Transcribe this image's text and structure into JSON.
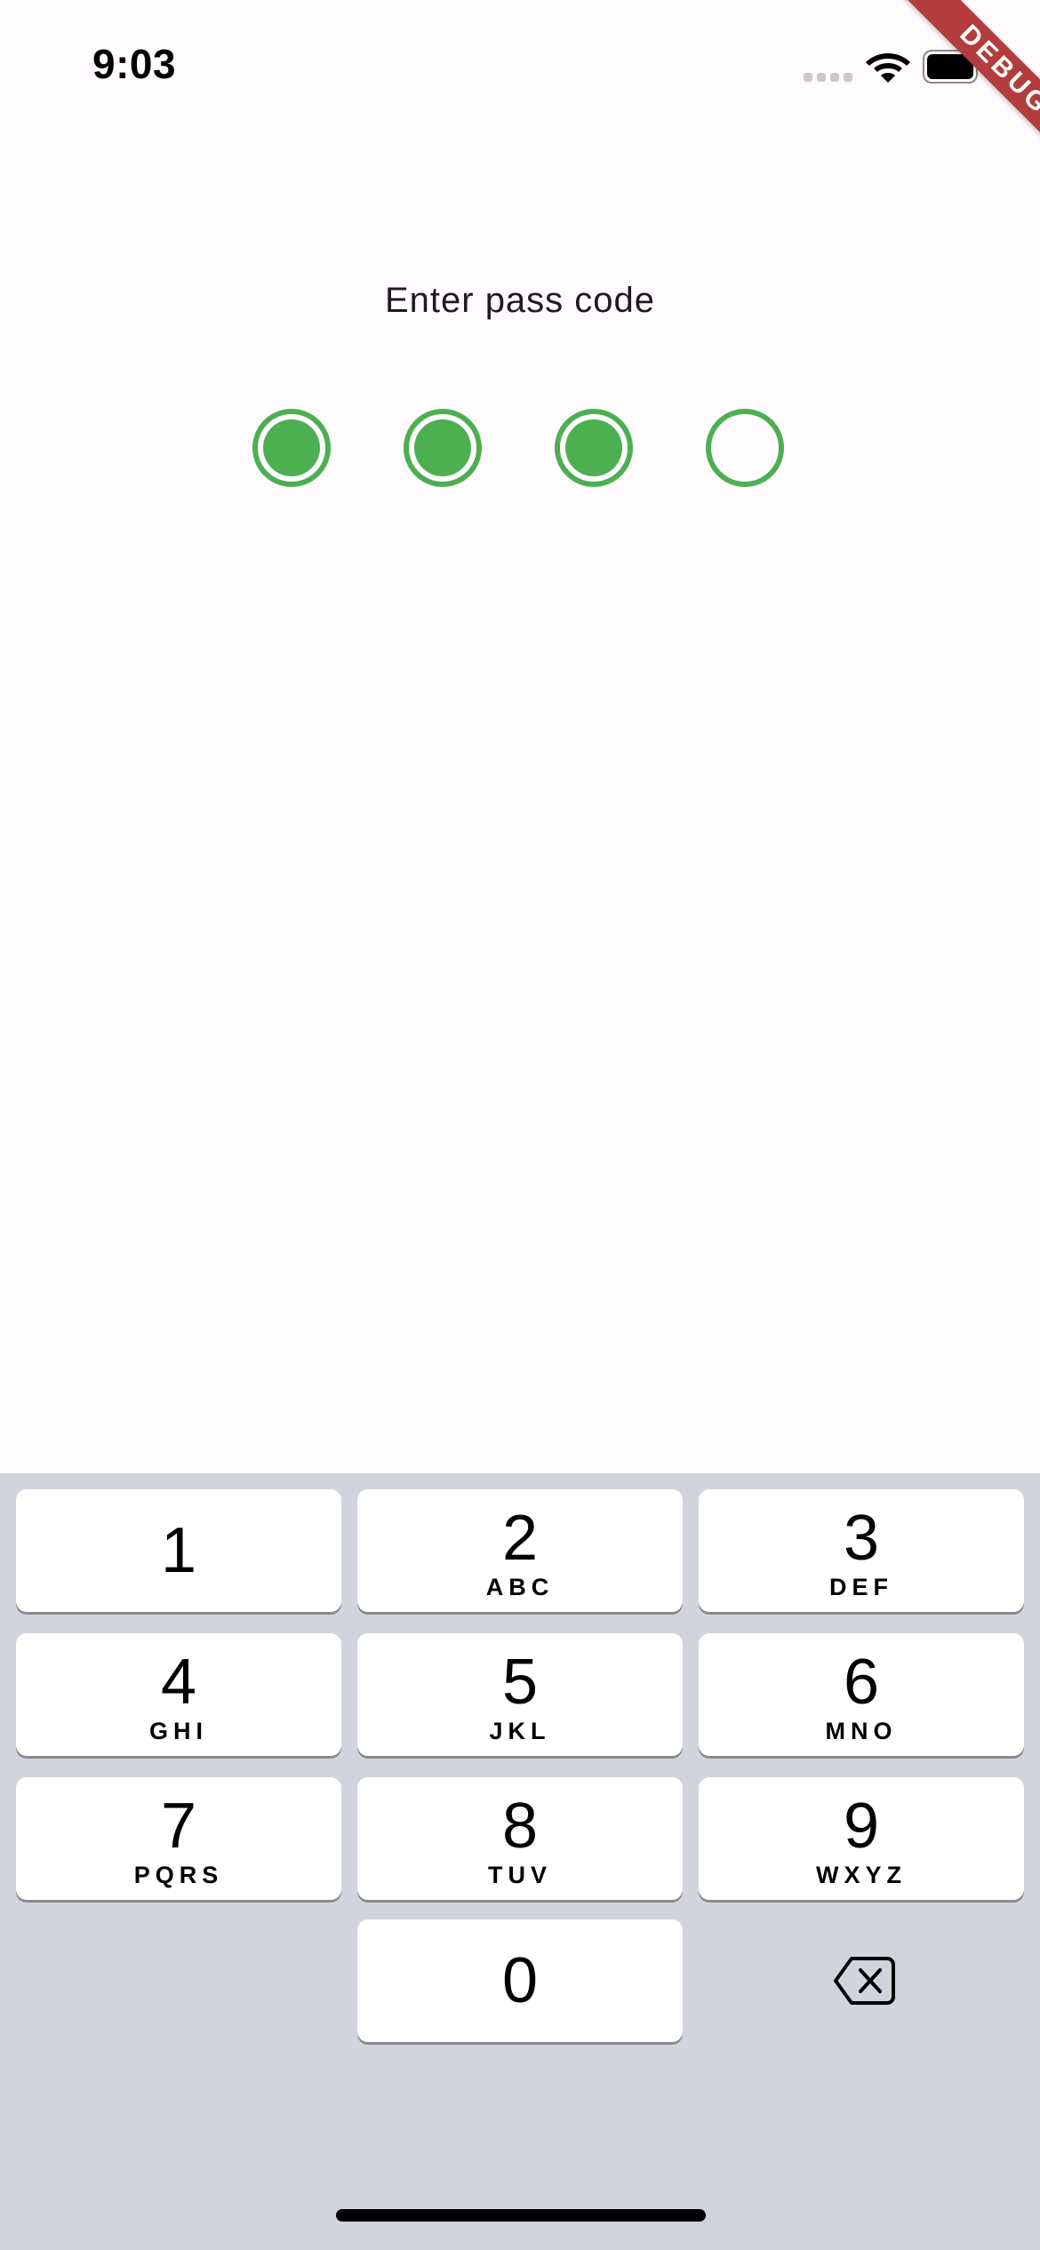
{
  "status_bar": {
    "time": "9:03",
    "icons": [
      "signal-icon",
      "wifi-icon",
      "battery-icon"
    ]
  },
  "debug_banner": {
    "label": "DEBUG",
    "color": "#b33c3c"
  },
  "passcode": {
    "prompt": "Enter pass code",
    "length": 4,
    "entered_count": 3,
    "accent_color": "#4caf50"
  },
  "keypad": {
    "background": "#d1d4db",
    "keys": [
      {
        "digit": "1",
        "letters": ""
      },
      {
        "digit": "2",
        "letters": "ABC"
      },
      {
        "digit": "3",
        "letters": "DEF"
      },
      {
        "digit": "4",
        "letters": "GHI"
      },
      {
        "digit": "5",
        "letters": "JKL"
      },
      {
        "digit": "6",
        "letters": "MNO"
      },
      {
        "digit": "7",
        "letters": "PQRS"
      },
      {
        "digit": "8",
        "letters": "TUV"
      },
      {
        "digit": "9",
        "letters": "WXYZ"
      },
      {
        "digit": "0",
        "letters": ""
      }
    ],
    "delete_icon": "backspace-icon"
  }
}
